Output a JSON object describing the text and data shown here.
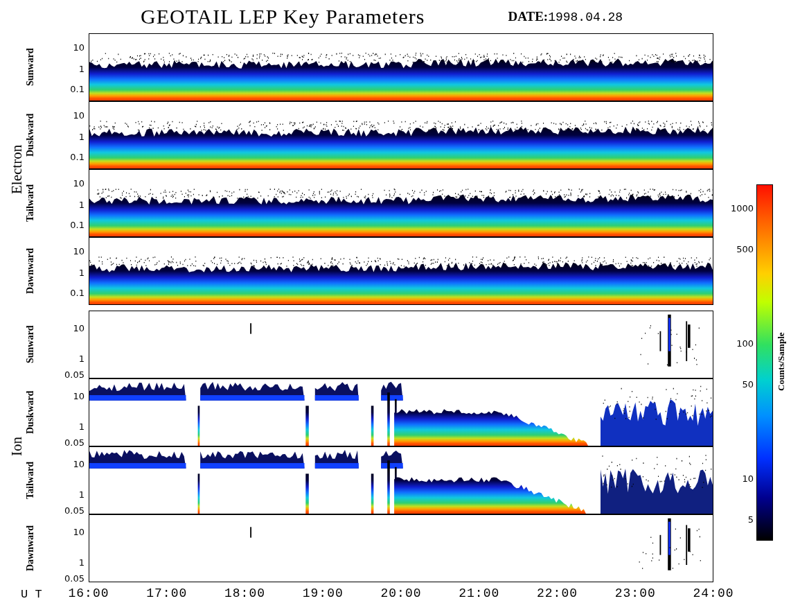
{
  "title": "GEOTAIL LEP Key Parameters",
  "date": {
    "label": "DATE:",
    "value": "1998.04.28"
  },
  "groups": [
    {
      "name": "Electron",
      "kind": "electron",
      "panels": [
        {
          "label": "Sunward",
          "kind": "band",
          "yticks": [
            "10",
            "1",
            "0.1"
          ]
        },
        {
          "label": "Duskward",
          "kind": "band",
          "yticks": [
            "10",
            "1",
            "0.1"
          ]
        },
        {
          "label": "Tailward",
          "kind": "band",
          "yticks": [
            "10",
            "1",
            "0.1"
          ]
        },
        {
          "label": "Dawnward",
          "kind": "band",
          "yticks": [
            "10",
            "1",
            "0.1"
          ]
        }
      ]
    },
    {
      "name": "Ion",
      "kind": "ion",
      "panels": [
        {
          "label": "Sunward",
          "kind": "sparse",
          "yticks": [
            "10",
            "1",
            "0.05"
          ]
        },
        {
          "label": "Duskward",
          "kind": "patchy",
          "yticks": [
            "10",
            "1",
            "0.05"
          ]
        },
        {
          "label": "Tailward",
          "kind": "patchy",
          "yticks": [
            "10",
            "1",
            "0.05"
          ]
        },
        {
          "label": "Dawnward",
          "kind": "sparse",
          "yticks": [
            "10",
            "1",
            "0.05"
          ]
        }
      ]
    }
  ],
  "colorbar": {
    "title": "Counts/Sample",
    "ticks": [
      "1000",
      "500",
      "100",
      "50",
      "10",
      "5"
    ]
  },
  "time_axis": {
    "label": "U T",
    "ticks": [
      "16:00",
      "17:00",
      "18:00",
      "19:00",
      "20:00",
      "21:00",
      "22:00",
      "23:00",
      "24:00"
    ]
  }
}
